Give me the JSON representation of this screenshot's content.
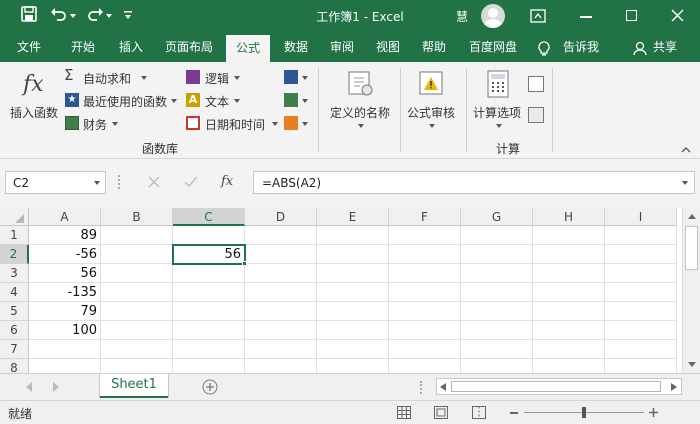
{
  "window": {
    "title": "工作簿1 - Excel",
    "user_initial": "慧"
  },
  "tabs": [
    "文件",
    "开始",
    "插入",
    "页面布局",
    "公式",
    "数据",
    "审阅",
    "视图",
    "帮助",
    "百度网盘",
    "告诉我",
    "共享"
  ],
  "active_tab": "公式",
  "ribbon": {
    "insert_function": "插入函数",
    "autosum": "自动求和",
    "recent": "最近使用的函数",
    "financial": "财务",
    "logical": "逻辑",
    "text": "文本",
    "datetime": "日期和时间",
    "group_library": "函数库",
    "defined_names": "定义的名称",
    "formula_auditing": "公式审核",
    "calc_options": "计算选项",
    "group_calc": "计算"
  },
  "formula_bar": {
    "name_box": "C2",
    "formula": "=ABS(A2)"
  },
  "columns": [
    "A",
    "B",
    "C",
    "D",
    "E",
    "F",
    "G",
    "H",
    "I"
  ],
  "rows": [
    "1",
    "2",
    "3",
    "4",
    "5",
    "6",
    "7",
    "8"
  ],
  "cells": {
    "A1": "89",
    "A2": "-56",
    "A3": "56",
    "A4": "-135",
    "A5": "79",
    "A6": "100",
    "C2": "56"
  },
  "sheet_tab": "Sheet1",
  "status": "就绪",
  "colors": {
    "accent": "#217346",
    "ribbon_bg": "#f3f3f3"
  }
}
